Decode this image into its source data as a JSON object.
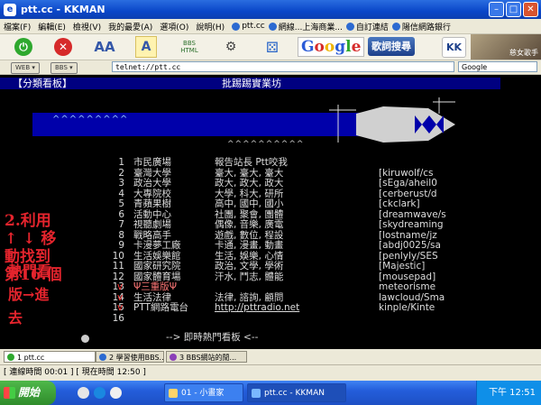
{
  "window": {
    "title": "ptt.cc - KKMAN",
    "minimize": "–",
    "maximize": "□",
    "close": "✕"
  },
  "menubar": {
    "items": [
      "檔案(F)",
      "編輯(E)",
      "檢視(V)",
      "我的最愛(A)",
      "選項(O)",
      "說明(H)"
    ],
    "tabs": [
      "ptt.cc",
      "網線...上海商業...",
      "自訂連結",
      "陽信網路銀行"
    ]
  },
  "toolbar": {
    "google": "Google",
    "lyrics": "歌詞搜尋",
    "kkbox": "KK",
    "cover_text": "慈女歌手",
    "bbs_html": "BBS HTML"
  },
  "address": {
    "web": "WEB ▾",
    "bbs": "BBS ▾",
    "url": "telnet://ptt.cc",
    "search": "Google"
  },
  "terminal": {
    "header_board": "【分類看板】",
    "header_name": "批踢踢實業坊",
    "tildes_top": "^^^^^^^^^",
    "tildes_mid": "^^^^^^^^^^",
    "rows": [
      {
        "num": "1",
        "name": "市民廣場",
        "cat": "報告站長 Ptt咬我",
        "side": ""
      },
      {
        "num": "2",
        "name": "臺灣大學",
        "cat": "臺大, 臺大, 臺大",
        "side": "[kiruwolf/cs"
      },
      {
        "num": "3",
        "name": "政治大學",
        "cat": "政大, 政大, 政大",
        "side": "[sEga/aheil0"
      },
      {
        "num": "4",
        "name": "大專院校",
        "cat": "大學, 科大, 研所",
        "side": "[cerberust/d"
      },
      {
        "num": "5",
        "name": "青蘋果樹",
        "cat": "高中, 國中, 國小",
        "side": "[ckclark]"
      },
      {
        "num": "6",
        "name": "活動中心",
        "cat": "社團, 聚會, 團體",
        "side": "[dreamwave/s"
      },
      {
        "num": "7",
        "name": "視聽劇場",
        "cat": "偶像, 音樂, 廣電",
        "side": "[skydreaming"
      },
      {
        "num": "8",
        "name": "戰略高手",
        "cat": "遊戲, 數位, 程設",
        "side": "[lostname/jz"
      },
      {
        "num": "9",
        "name": "卡漫夢工廠",
        "cat": "卡通, 漫畫, 動畫",
        "side": "[abdj0025/sa"
      },
      {
        "num": "10",
        "name": "生活娛樂館",
        "cat": "生活, 娛樂, 心情",
        "side": "[penlyly/SES"
      },
      {
        "num": "11",
        "name": "國家研究院",
        "cat": "政治, 文學, 學術",
        "side": "[Majestic]"
      },
      {
        "num": "12",
        "name": "國家體育場",
        "cat": "汗水, 鬥志, 體能",
        "side": "[mousepad]"
      },
      {
        "num": "13",
        "name": "Ψ三重版Ψ",
        "cat": "",
        "side": "meteorisme"
      },
      {
        "num": "14",
        "name": "生活法律",
        "cat": "法律, 諮詢, 顧問",
        "side": "lawcloud/Sma"
      },
      {
        "num": "15",
        "name": "PTT網路電台",
        "cat": "http://pttradio.net",
        "side": "kinple/Kinte"
      },
      {
        "num": "16",
        "name": "",
        "cat": "",
        "side": ""
      }
    ],
    "hot_boards": "--> 即時熱門看板 <--"
  },
  "annotation": {
    "line1": "2.利用",
    "line2": "↑ ↓ 移",
    "line3": "動找到",
    "line4": "第16.個",
    "line5": "熱門看",
    "line6": "版→進",
    "line7": "去"
  },
  "tabs": [
    "1 ptt.cc",
    "2 學習使用BBS...",
    "3 BBS網站的閒..."
  ],
  "status": {
    "text": "[ 連線時間 00:01 ] [ 現在時間 12:50 ]"
  },
  "taskbar": {
    "start": "開始",
    "items": [
      "01 - 小畫家",
      "ptt.cc - KKMAN"
    ],
    "clock": "下午 12:51"
  },
  "colors": {
    "terminal_bg": "#000000",
    "header_bg": "#000080",
    "annotation": "#e4242d",
    "highlight_row": "#ff7777"
  }
}
